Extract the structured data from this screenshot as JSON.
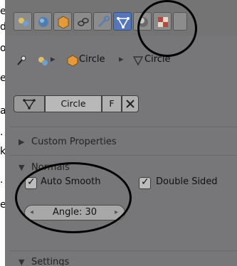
{
  "doc_text": [
    "e",
    "d",
    "o",
    "e",
    "a",
    ".",
    "k",
    ".",
    "e"
  ],
  "breadcrumb": {
    "item1": "Circle",
    "item2": "Circle"
  },
  "datablock": {
    "name": "Circle",
    "fake_user": "F"
  },
  "sections": {
    "custom_properties": "Custom Properties",
    "normals": "Normals",
    "settings": "Settings"
  },
  "normals": {
    "auto_smooth_label": "Auto Smooth",
    "auto_smooth_checked": true,
    "double_sided_label": "Double Sided",
    "double_sided_checked": true,
    "angle_label": "Angle: 30"
  },
  "tabs": [
    "render-tab",
    "world-tab",
    "object-tab",
    "constraints-tab",
    "modifiers-tab",
    "mesh-data-tab",
    "material-tab",
    "texture-tab",
    "particles-tab"
  ],
  "colors": {
    "panel_bg": "#777779",
    "active_tab": "#5577ba",
    "annotation": "#000000"
  }
}
